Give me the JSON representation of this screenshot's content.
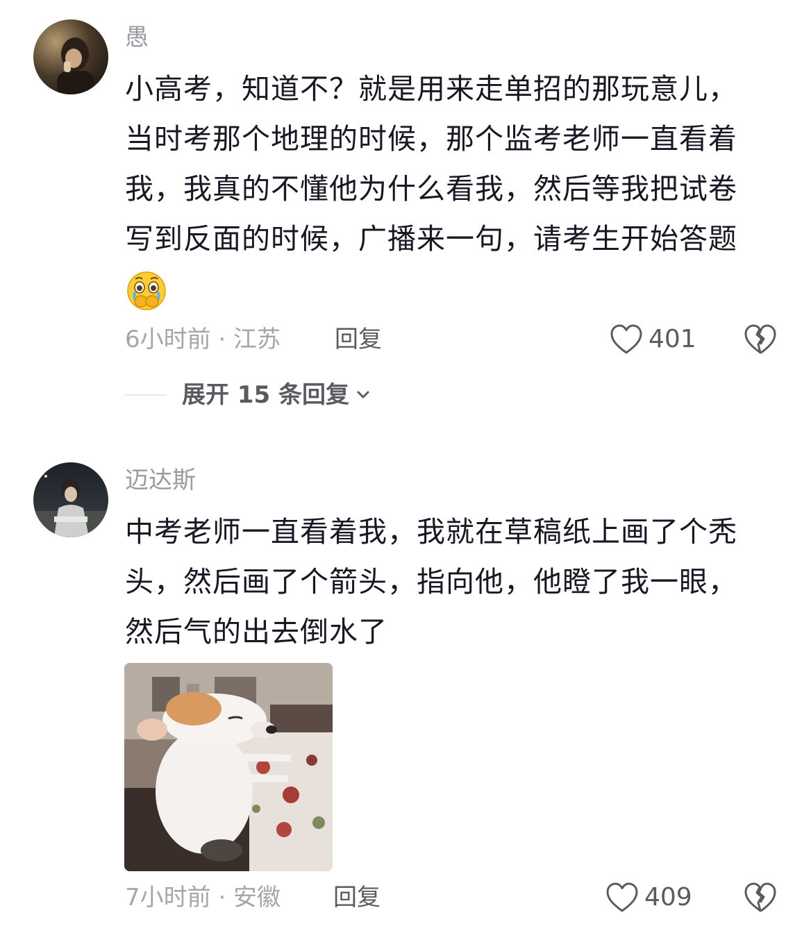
{
  "comments": [
    {
      "username": "愚",
      "lines": [
        "小高考，知道不？就是用来走单招的那玩意儿，",
        "当时考那个地理的时候，那个监考老师一直看着",
        "我，我真的不懂他为什么看我，然后等我把试卷",
        "写到反面的时候，广播来一句，请考生开始答题"
      ],
      "emoji": "crying-face-emoji",
      "time_location": "6小时前 · 江苏",
      "reply_label": "回复",
      "like_count": "401",
      "expand_label": "展开 15 条回复"
    },
    {
      "username": "迈达斯",
      "lines": [
        "中考老师一直看着我，我就在草稿纸上画了个秃",
        "头，然后画了个箭头，指向他，他瞪了我一眼，",
        "然后气的出去倒水了"
      ],
      "media": "dog-sitting-at-table-image",
      "time_location": "7小时前 · 安徽",
      "reply_label": "回复",
      "like_count": "409"
    }
  ],
  "colors": {
    "text": "#161823",
    "muted": "#a5a5aa",
    "secondary": "#5a5a60"
  }
}
